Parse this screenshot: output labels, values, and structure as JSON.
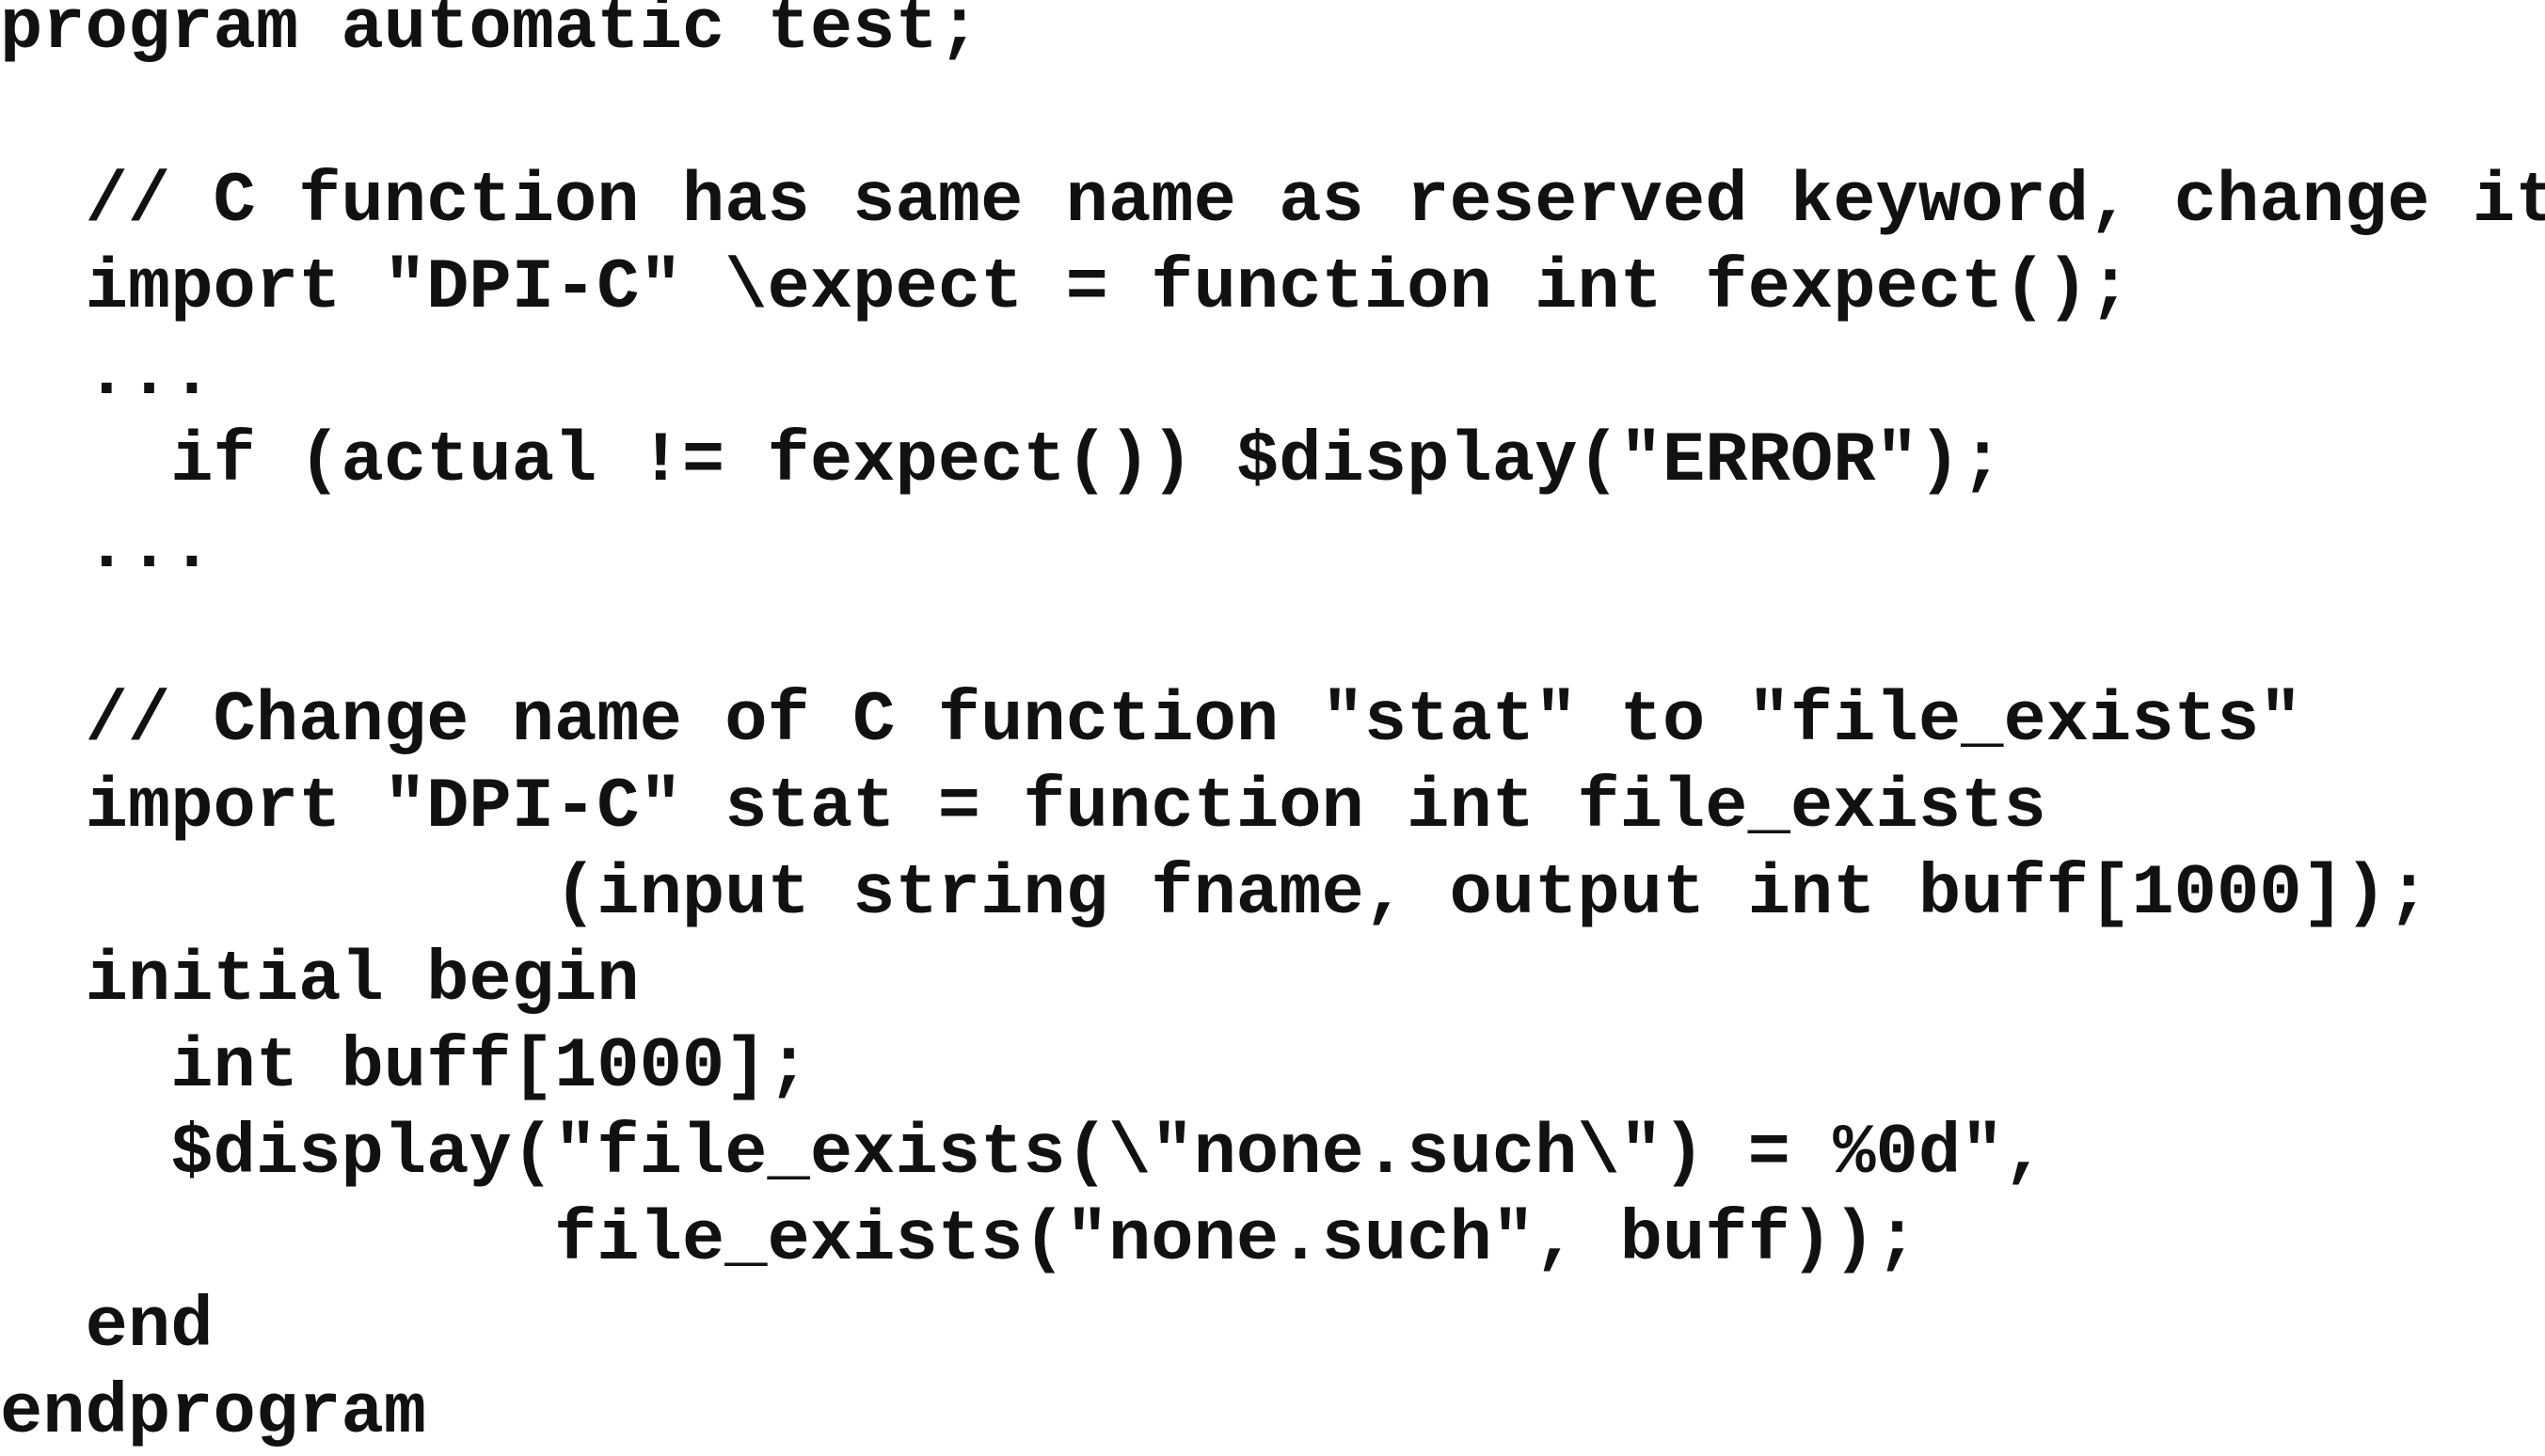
{
  "code": {
    "lines": [
      "program automatic test;",
      "",
      "  // C function has same name as reserved keyword, change it",
      "  import \"DPI-C\" \\expect = function int fexpect();",
      "  ...",
      "    if (actual != fexpect()) $display(\"ERROR\");",
      "  ...",
      "",
      "  // Change name of C function \"stat\" to \"file_exists\"",
      "  import \"DPI-C\" stat = function int file_exists",
      "             (input string fname, output int buff[1000]);",
      "  initial begin",
      "    int buff[1000];",
      "    $display(\"file_exists(\\\"none.such\\\") = %0d\",",
      "             file_exists(\"none.such\", buff));",
      "  end",
      "endprogram"
    ]
  }
}
